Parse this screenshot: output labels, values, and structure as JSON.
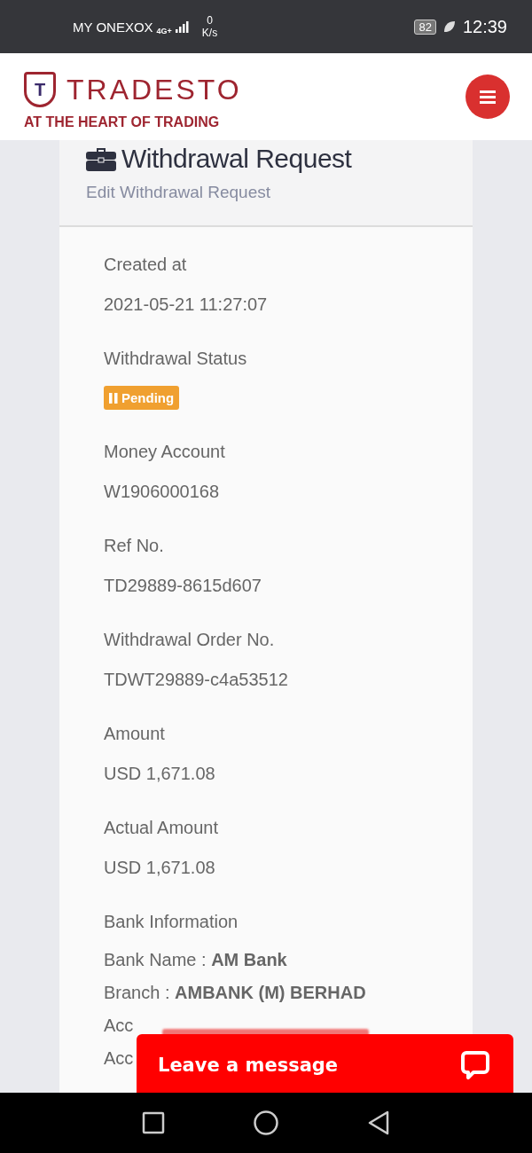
{
  "status_bar": {
    "carrier": "MY ONEXOX",
    "network": "4G+",
    "speed_value": "0",
    "speed_unit": "K/s",
    "battery": "82",
    "time": "12:39"
  },
  "header": {
    "logo_letter": "T",
    "brand": "TRADESTO",
    "tagline": "AT THE HEART OF TRADING"
  },
  "page": {
    "title": "Withdrawal Request",
    "subtitle": "Edit Withdrawal Request"
  },
  "fields": [
    {
      "kind": "text",
      "label": "Created at",
      "value": "2021-05-21 11:27:07"
    },
    {
      "kind": "badge",
      "label": "Withdrawal Status",
      "value": "Pending"
    },
    {
      "kind": "text",
      "label": "Money Account",
      "value": "W1906000168"
    },
    {
      "kind": "text",
      "label": "Ref No.",
      "value": "TD29889-8615d607"
    },
    {
      "kind": "text",
      "label": "Withdrawal Order No.",
      "value": "TDWT29889-c4a53512"
    },
    {
      "kind": "text",
      "label": "Amount",
      "value": "USD 1,671.08"
    },
    {
      "kind": "text",
      "label": "Actual Amount",
      "value": "USD 1,671.08"
    }
  ],
  "bank": {
    "label": "Bank Information",
    "lines": [
      {
        "label": "Bank Name :",
        "value": "AM Bank"
      },
      {
        "label": "Branch :",
        "value": "AMBANK (M) BERHAD"
      },
      {
        "label": "Acc"
      },
      {
        "label": "Acc"
      }
    ]
  },
  "chat": {
    "label": "Leave a message"
  }
}
